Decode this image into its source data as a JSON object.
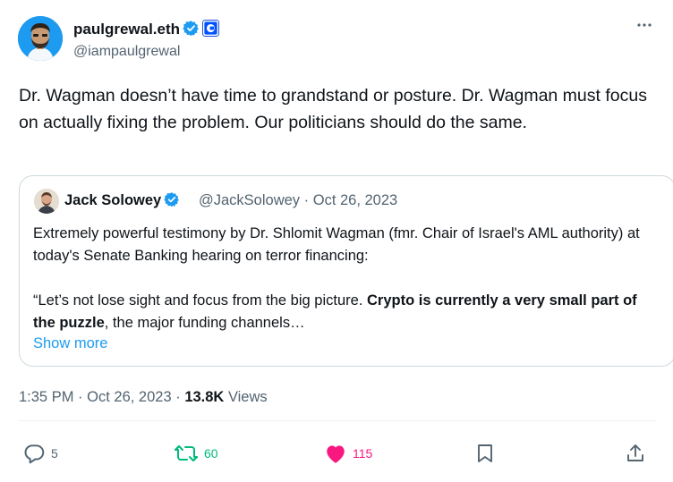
{
  "tweet": {
    "author_name": "paulgrewal.eth",
    "author_handle": "@iampaulgrewal",
    "more_icon": "ellipsis-icon",
    "text": "Dr. Wagman doesn’t have time to grandstand or posture. Dr. Wagman must focus on actually fixing the problem. Our politicians should do the same.",
    "timestamp": "1:35 PM",
    "date": "Oct 26, 2023",
    "views_count": "13.8K",
    "views_label": "Views"
  },
  "quote": {
    "author_name": "Jack Solowey",
    "author_handle": "@JackSolowey",
    "separator": "·",
    "date": "Oct 26, 2023",
    "para1": "Extremely powerful testimony by Dr. Shlomit Wagman (fmr. Chair of Israel's AML authority) at today's Senate Banking hearing on terror financing:",
    "para2_start": "“Let’s not lose sight and focus from the big picture. ",
    "para2_bold": "Crypto is currently a very small part of the puzzle",
    "para2_end": ", the major funding channels…",
    "show_more": "Show more"
  },
  "actions": {
    "replies": "5",
    "reposts": "60",
    "likes": "115"
  },
  "colors": {
    "verified": "#1d9bf0",
    "repost": "#00ba7c",
    "like": "#f91880",
    "muted": "#536471",
    "link": "#1d9bf0"
  }
}
